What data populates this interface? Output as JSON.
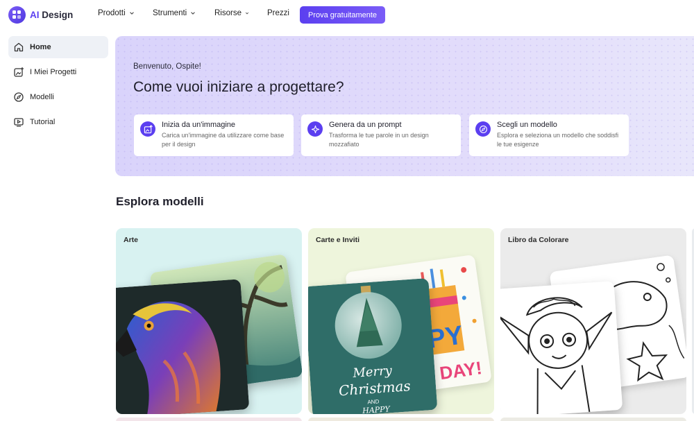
{
  "brand": {
    "prefix": "AI",
    "name": "Design"
  },
  "nav": {
    "items": [
      {
        "label": "Prodotti",
        "has_dropdown": true
      },
      {
        "label": "Strumenti",
        "has_dropdown": true
      },
      {
        "label": "Risorse",
        "has_dropdown": true
      },
      {
        "label": "Prezzi",
        "has_dropdown": false
      }
    ],
    "cta_label": "Prova gratuitamente"
  },
  "sidebar": {
    "items": [
      {
        "label": "Home",
        "icon": "home-icon",
        "active": true
      },
      {
        "label": "I Miei Progetti",
        "icon": "image-plus-icon",
        "active": false
      },
      {
        "label": "Modelli",
        "icon": "compass-icon",
        "active": false
      },
      {
        "label": "Tutorial",
        "icon": "play-icon",
        "active": false
      }
    ]
  },
  "hero": {
    "greeting": "Benvenuto, Ospite!",
    "title": "Come vuoi iniziare a progettare?",
    "options": [
      {
        "title": "Inizia da un'immagine",
        "desc": "Carica un'immagine da utilizzare come base per il design",
        "icon": "image-upload-icon"
      },
      {
        "title": "Genera da un prompt",
        "desc": "Trasforma le tue parole in un design mozzafiato",
        "icon": "sparkle-icon"
      },
      {
        "title": "Scegli un modello",
        "desc": "Esplora e seleziona un modello che soddisfi le tue esigenze",
        "icon": "compass-icon"
      }
    ]
  },
  "templates": {
    "section_title": "Esplora modelli",
    "cards": [
      {
        "label": "Arte",
        "color": "#d8f2f1"
      },
      {
        "label": "Carte e Inviti",
        "color": "#eef5dc"
      },
      {
        "label": "Libro da Colorare",
        "color": "#ebebeb"
      }
    ],
    "card2_front_text": [
      "Merry",
      "Christmas",
      "AND",
      "HAPPY"
    ],
    "card2_back_text": [
      "PY",
      "DAY!"
    ]
  },
  "colors": {
    "accent": "#5b3ff0",
    "hero_bg": "#ddd7fb"
  }
}
